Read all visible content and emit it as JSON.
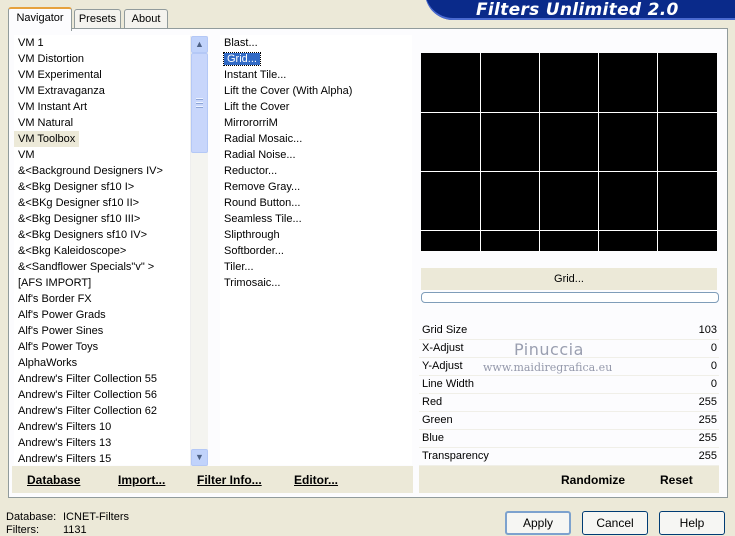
{
  "app_title": "Filters Unlimited 2.0",
  "tabs": [
    "Navigator",
    "Presets",
    "About"
  ],
  "categories": [
    "VM 1",
    "VM Distortion",
    "VM Experimental",
    "VM Extravaganza",
    "VM Instant Art",
    "VM Natural",
    "VM Toolbox",
    "VM",
    "&<Background Designers IV>",
    "&<Bkg Designer sf10 I>",
    "&<BKg Designer sf10 II>",
    "&<Bkg Designer sf10 III>",
    "&<Bkg Designers sf10 IV>",
    "&<Bkg Kaleidoscope>",
    "&<Sandflower Specials\"v\" >",
    "[AFS IMPORT]",
    "Alf's Border FX",
    "Alf's Power Grads",
    "Alf's Power Sines",
    "Alf's Power Toys",
    "AlphaWorks",
    "Andrew's Filter Collection 55",
    "Andrew's Filter Collection 56",
    "Andrew's Filter Collection 62",
    "Andrew's Filters 10",
    "Andrew's Filters 13",
    "Andrew's Filters 15"
  ],
  "selected_category": "VM Toolbox",
  "filters": [
    "Blast...",
    "Grid...",
    "Instant Tile...",
    "Lift the Cover (With Alpha)",
    "Lift the Cover",
    "MirrororriM",
    "Radial Mosaic...",
    "Radial Noise...",
    "Reductor...",
    "Remove Gray...",
    "Round Button...",
    "Seamless Tile...",
    "Slipthrough",
    "Softborder...",
    "Tiler...",
    "Trimosaic..."
  ],
  "selected_filter": "Grid...",
  "preview_filter_name": "Grid...",
  "params": [
    {
      "label": "Grid Size",
      "value": "103"
    },
    {
      "label": "X-Adjust",
      "value": "0"
    },
    {
      "label": "Y-Adjust",
      "value": "0"
    },
    {
      "label": "Line Width",
      "value": "0"
    },
    {
      "label": "Red",
      "value": "255"
    },
    {
      "label": "Green",
      "value": "255"
    },
    {
      "label": "Blue",
      "value": "255"
    },
    {
      "label": "Transparency",
      "value": "255"
    }
  ],
  "watermark": {
    "name": "Pinuccia",
    "url": "www.maidiregrafica.eu"
  },
  "bottom_links": {
    "database": "Database",
    "import": "Import...",
    "filter_info": "Filter Info...",
    "editor": "Editor...",
    "randomize": "Randomize",
    "reset": "Reset"
  },
  "status": {
    "database_label": "Database:",
    "database_value": "ICNET-Filters",
    "filters_label": "Filters:",
    "filters_value": "1131"
  },
  "buttons": {
    "apply": "Apply",
    "cancel": "Cancel",
    "help": "Help"
  },
  "colors": {
    "banner": "#0a2a8a",
    "selection": "#316ac5",
    "tab_highlight": "#e6a13d"
  }
}
